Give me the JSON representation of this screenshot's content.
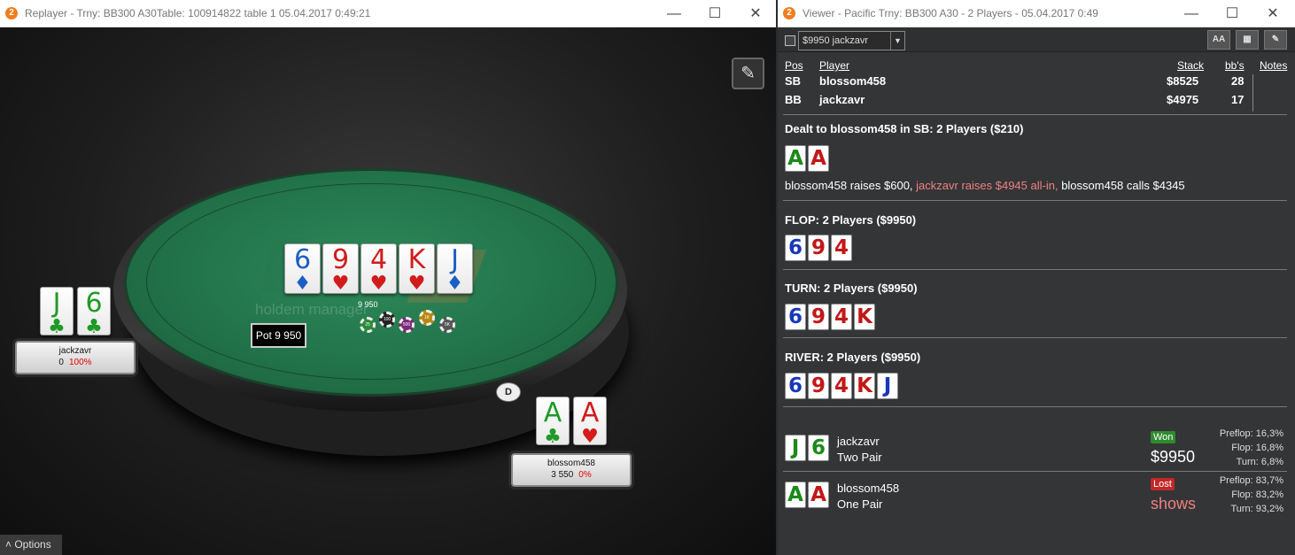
{
  "replayer": {
    "title": "Replayer - Trny: BB300 A30Table: 100914822 table 1     05.04.2017 0:49:21",
    "board": [
      {
        "rank": "6",
        "suit": "♦",
        "color": "blue"
      },
      {
        "rank": "9",
        "suit": "♥",
        "color": "red"
      },
      {
        "rank": "4",
        "suit": "♥",
        "color": "red"
      },
      {
        "rank": "K",
        "suit": "♥",
        "color": "red"
      },
      {
        "rank": "J",
        "suit": "♦",
        "color": "blue"
      }
    ],
    "watermark": "holdem manager",
    "pot_label": "Pot 9 950",
    "pot_amount": "9 950",
    "chips": [
      "25",
      "100",
      "500",
      "1K",
      "5K"
    ],
    "seats": [
      {
        "name": "jackzavr",
        "stack": "0",
        "pct": "100%",
        "cards": [
          {
            "rank": "J",
            "suit": "♣"
          },
          {
            "rank": "6",
            "suit": "♣"
          }
        ]
      },
      {
        "name": "blossom458",
        "stack": "3 550",
        "pct": "0%",
        "cards": [
          {
            "rank": "A",
            "suit": "♣",
            "color": "green"
          },
          {
            "rank": "A",
            "suit": "♥",
            "color": "red"
          }
        ]
      }
    ],
    "dealer": "D",
    "options_label": "˄  Options"
  },
  "viewer": {
    "title": "Viewer - Pacific Trny: BB300 A30 - 2 Players - 05.04.2017 0:49",
    "selector": "$9950 jackzavr",
    "toolbar_buttons": [
      "AA",
      "▦",
      "✎"
    ],
    "headers": {
      "pos": "Pos",
      "player": "Player",
      "stack": "Stack",
      "bbs": "bb's",
      "notes": "Notes"
    },
    "players": [
      {
        "pos": "SB",
        "name": "blossom458",
        "stack": "$8525",
        "bbs": "28"
      },
      {
        "pos": "BB",
        "name": "jackzavr",
        "stack": "$4975",
        "bbs": "17"
      }
    ],
    "dealt_line": "Dealt to blossom458 in SB: 2 Players ($210)",
    "action_a": "blossom458 raises $600,",
    "action_b": "jackzavr raises $4945 all-in,",
    "action_c": "blossom458 calls $4345",
    "flop_label": "FLOP: 2 Players ($9950)",
    "turn_label": "TURN: 2 Players ($9950)",
    "river_label": "RIVER: 2 Players ($9950)",
    "results": [
      {
        "name": "jackzavr",
        "hand": "Two Pair",
        "badge": "Won",
        "amount": "$9950",
        "eq": {
          "preflop": "16,3%",
          "flop": "16,8%",
          "turn": "6,8%"
        }
      },
      {
        "name": "blossom458",
        "hand": "One Pair",
        "badge": "Lost",
        "amount": "shows",
        "eq": {
          "preflop": "83,7%",
          "flop": "83,2%",
          "turn": "93,2%"
        }
      }
    ],
    "eq_labels": {
      "preflop": "Preflop:",
      "flop": "Flop:",
      "turn": "Turn:"
    }
  },
  "colors": {
    "accent": "#f07c1d",
    "felt": "#217048",
    "won": "#2e8b2e",
    "lost": "#c22828",
    "raise_text": "#f08080"
  }
}
